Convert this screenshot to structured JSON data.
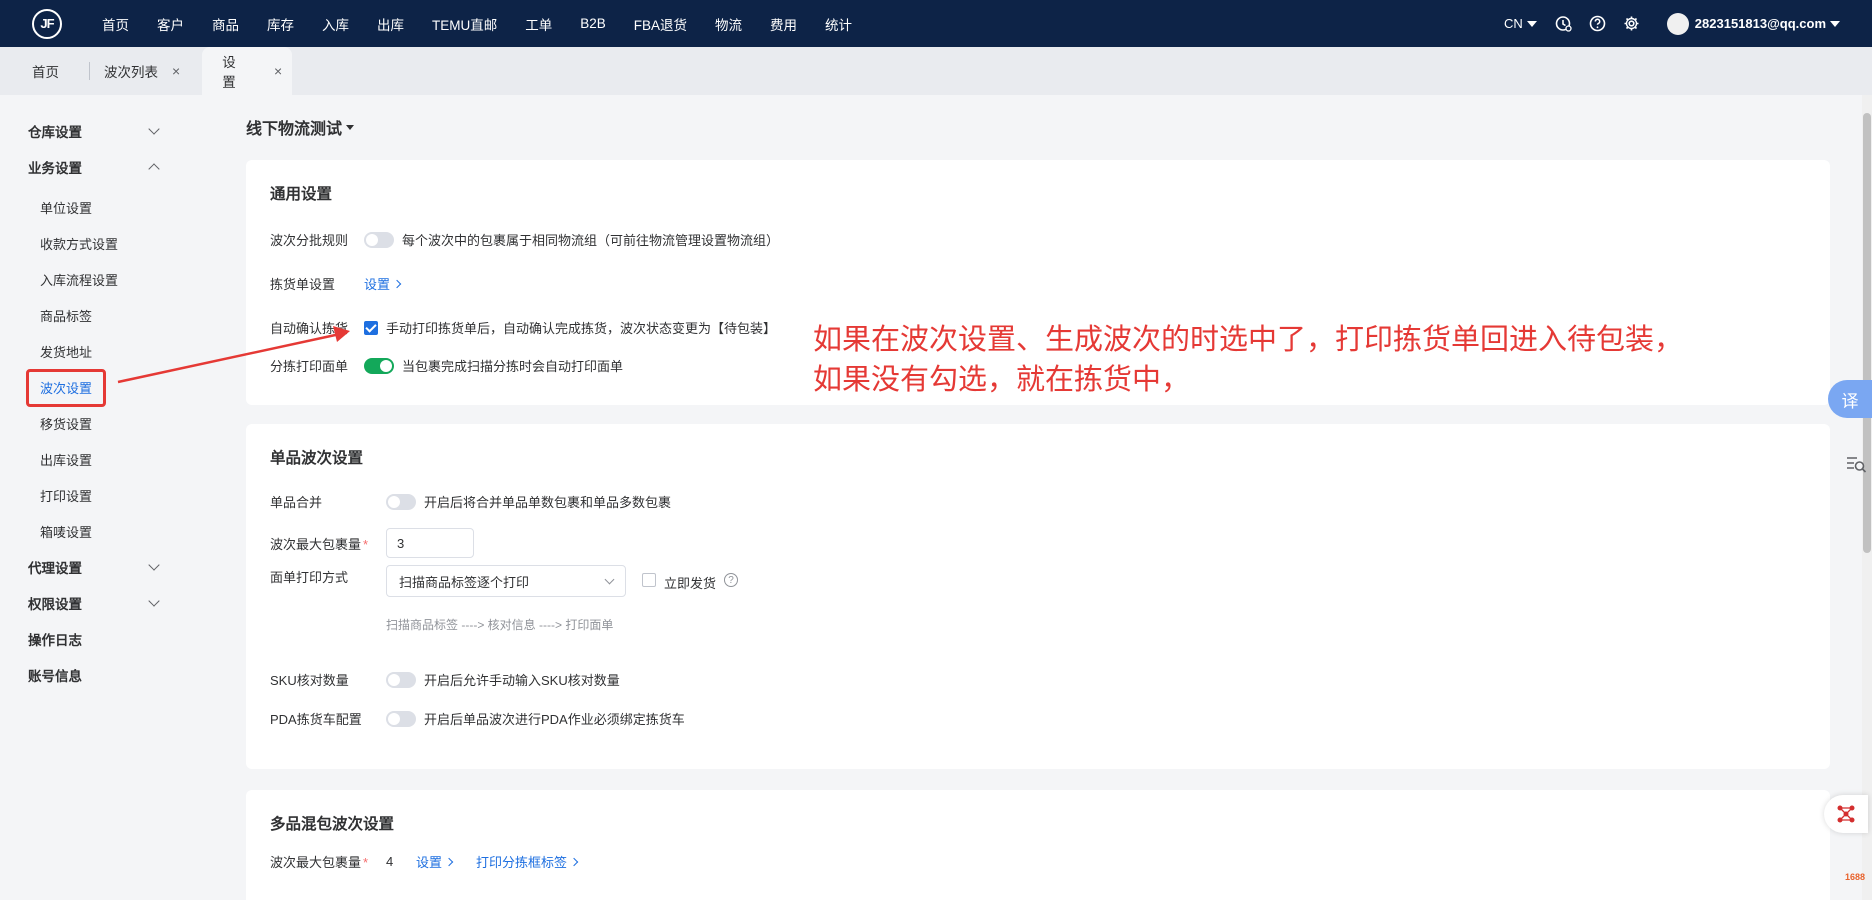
{
  "topbar": {
    "logo_text": "JF",
    "nav": [
      "首页",
      "客户",
      "商品",
      "库存",
      "入库",
      "出库",
      "TEMU直邮",
      "工单",
      "B2B",
      "FBA退货",
      "物流",
      "费用",
      "统计"
    ],
    "lang": "CN",
    "user_email": "2823151813@qq.com"
  },
  "tabs": [
    {
      "label": "首页"
    },
    {
      "label": "波次列表"
    },
    {
      "label": "设置"
    }
  ],
  "sidebar": {
    "groups": {
      "warehouse": "仓库设置",
      "business": "业务设置",
      "agent": "代理设置",
      "permission": "权限设置",
      "oplog": "操作日志",
      "account": "账号信息"
    },
    "business_items": [
      "单位设置",
      "收款方式设置",
      "入库流程设置",
      "商品标签",
      "发货地址",
      "波次设置",
      "移货设置",
      "出库设置",
      "打印设置",
      "箱唛设置"
    ]
  },
  "page": {
    "title": "线下物流测试"
  },
  "general": {
    "title": "通用设置",
    "wave_rule_label": "波次分批规则",
    "wave_rule_text": "每个波次中的包裹属于相同物流组（可前往物流管理设置物流组）",
    "pick_list_label": "拣货单设置",
    "pick_list_link": "设置",
    "auto_confirm_label": "自动确认拣货",
    "auto_confirm_text": "手动打印拣货单后，自动确认完成拣货，波次状态变更为【待包装】",
    "sort_print_label": "分拣打印面单",
    "sort_print_text": "当包裹完成扫描分拣时会自动打印面单"
  },
  "single": {
    "title": "单品波次设置",
    "merge_label": "单品合并",
    "merge_text": "开启后将合并单品单数包裹和单品多数包裹",
    "max_pkg_label": "波次最大包裹量",
    "max_pkg_value": "3",
    "print_mode_label": "面单打印方式",
    "print_mode_value": "扫描商品标签逐个打印",
    "ship_now_label": "立即发货",
    "flow_hint": "扫描商品标签 ---->   核对信息 ---->   打印面单",
    "sku_check_label": "SKU核对数量",
    "sku_check_text": "开启后允许手动输入SKU核对数量",
    "pda_label": "PDA拣货车配置",
    "pda_text": "开启后单品波次进行PDA作业必须绑定拣货车"
  },
  "multi": {
    "title": "多品混包波次设置",
    "max_pkg_label": "波次最大包裹量",
    "max_pkg_value": "4",
    "settings_link": "设置",
    "print_box_link": "打印分拣框标签"
  },
  "annotation": {
    "line1": "如果在波次设置、生成波次的时选中了，打印拣货单回进入待包装，",
    "line2": "如果没有勾选，就在拣货中，"
  },
  "floating": {
    "translate": "译",
    "brand": "1688"
  },
  "colors": {
    "topbar_bg": "#0d2347",
    "accent_blue": "#1e6fe0",
    "switch_on": "#13a85a",
    "annotation_red": "#e53935"
  }
}
